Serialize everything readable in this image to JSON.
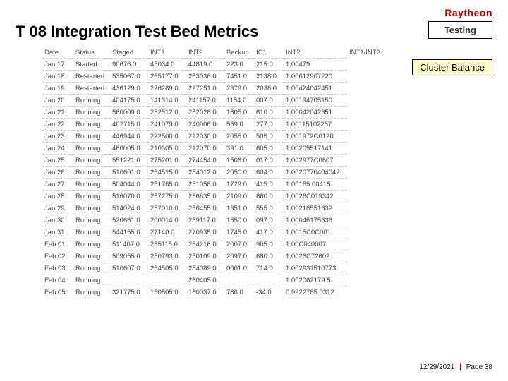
{
  "brand": "Raytheon",
  "title": "T 08 Integration Test Bed Metrics",
  "testing_label": "Testing",
  "cluster_label": "Cluster Balance",
  "footer": {
    "date": "12/29/2021",
    "page_label": "Page 38"
  },
  "table": {
    "headers": [
      "Date",
      "Status",
      "Staged",
      "INT1",
      "INT2",
      "Backup",
      "IC1",
      "INT2",
      "INT1/INT2"
    ],
    "rows": [
      [
        "Jan 17",
        "Started",
        "90676.0",
        "45034.0",
        "44819.0",
        "223.0",
        "215.0",
        "1.00479"
      ],
      [
        "Jan 18",
        "Restarted",
        "535067.0",
        "255177.0",
        "263036.0",
        "7451.0",
        "2138.0",
        "1.00612907220"
      ],
      [
        "Jan 19",
        "Restarted",
        "436129.0",
        "226289.0",
        "227251.0",
        "2379.0",
        "2038.0",
        "1.00424042451"
      ],
      [
        "Jan 20",
        "Running",
        "404175.0",
        "141314.0",
        "241157.0",
        "1154.0",
        "007.0",
        "1.00194705150"
      ],
      [
        "Jan 21",
        "Running",
        "560009.0",
        "252512.0",
        "252026.0",
        "1605.0",
        "610.0",
        "1.00042042351"
      ],
      [
        "Jan 22",
        "Running",
        "402715.0",
        "241079.0",
        "240006.0",
        "569.0",
        "277.0",
        "1.00115102257"
      ],
      [
        "Jan 23",
        "Running",
        "446944.0",
        "222500.0",
        "222030.0",
        "2055.0",
        "505.0",
        "1.001972C0120"
      ],
      [
        "Jan 24",
        "Running",
        "460005.0",
        "210305.0",
        "212070.0",
        "391.0",
        "605.0",
        "1.00205517141"
      ],
      [
        "Jan 25",
        "Running",
        "551221.0",
        "275201.0",
        "274454.0",
        "1506.0",
        "017.0",
        "1.002977C0607"
      ],
      [
        "Jan 26",
        "Running",
        "510601.0",
        "254515.0",
        "254012.0",
        "2050.0",
        "604.0",
        "1.0020770404042"
      ],
      [
        "Jan 27",
        "Running",
        "504044.0",
        "251765.0",
        "251058.0",
        "1729.0",
        "415.0",
        "1.00165.00415"
      ],
      [
        "Jan 28",
        "Running",
        "516070.0",
        "257275.0",
        "256635.0",
        "2109.0",
        "660.0",
        "1.0026C019342"
      ],
      [
        "Jan 29",
        "Running",
        "514024.0",
        "257010.0",
        "256455.0",
        "1351.0",
        "555.0",
        "1.00216551632"
      ],
      [
        "Jan 30",
        "Running",
        "520661.0",
        "200014.0",
        "259117.0",
        "1650.0",
        "097.0",
        "1.00046175636"
      ],
      [
        "Jan 31",
        "Running",
        "544155.0",
        "27140.0",
        "270935.0",
        "1745.0",
        "417.0",
        "1.0015C0C001"
      ],
      [
        "Feb 01",
        "Running",
        "511407.0",
        "255115.0",
        "254216.0",
        "2007.0",
        "905.0",
        "1.00C040007"
      ],
      [
        "Feb 02",
        "Running",
        "509055.0",
        "250793.0",
        "250109.0",
        "2097.0",
        "680.0",
        "1.0026C72602"
      ],
      [
        "Feb 03",
        "Running",
        "510607.0",
        "254505.0",
        "254089.0",
        "0001.0",
        "714.0",
        "1.002931510773"
      ],
      [
        "Feb 04",
        "Running",
        "",
        "",
        "260405.0",
        "",
        "",
        "1.002062179.5"
      ],
      [
        "Feb 05",
        "Running",
        "321775.0",
        "160505.0",
        "160037.0",
        "786.0",
        "-34.0",
        "0.9922785.0312"
      ]
    ]
  }
}
